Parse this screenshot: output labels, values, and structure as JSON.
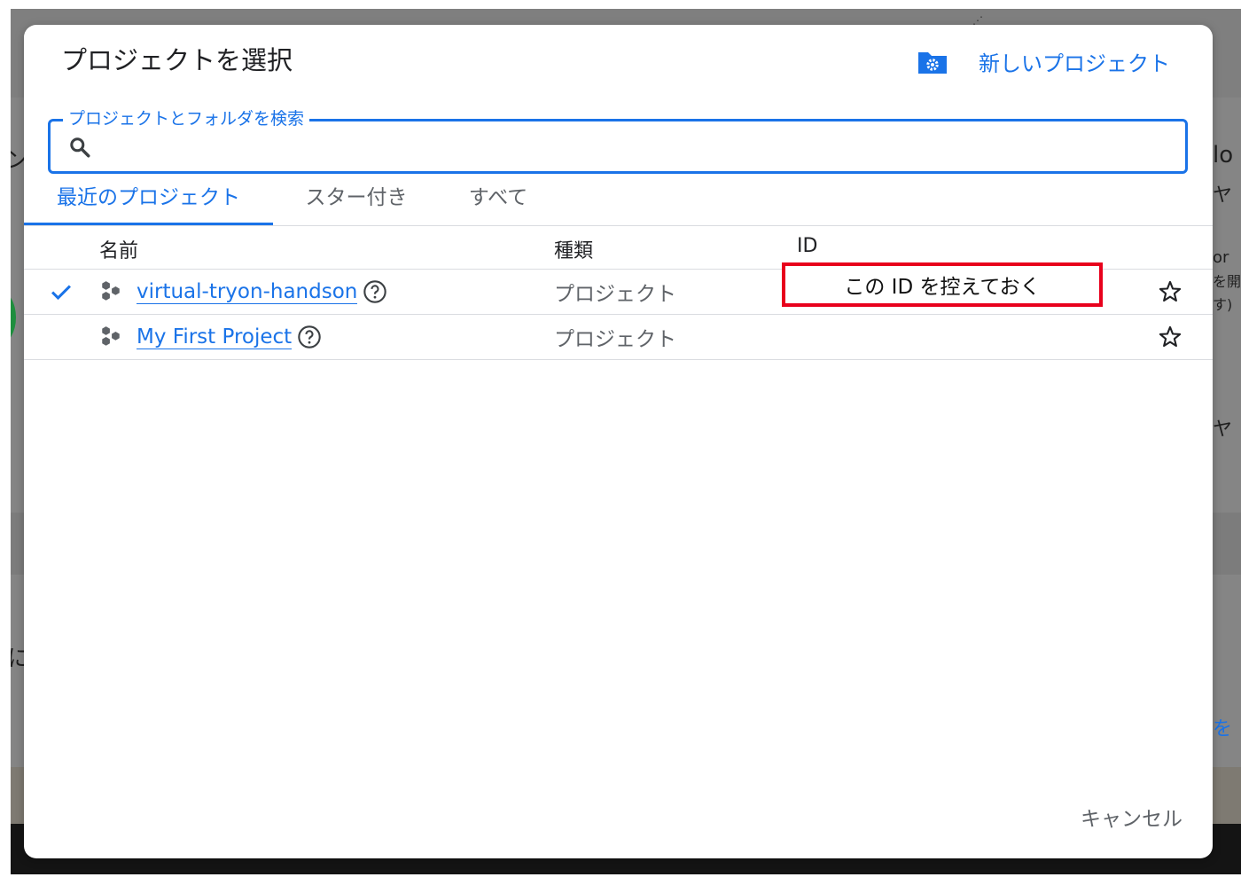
{
  "background": {
    "fragments": [
      "ン",
      "lo",
      "ヤ",
      "or",
      "を開",
      "す)",
      "ヤ",
      "に",
      "を"
    ]
  },
  "dialog": {
    "title": "プロジェクトを選択",
    "new_project_label": "新しいプロジェクト",
    "new_project_icon": "folder-settings-icon",
    "search": {
      "label": "プロジェクトとフォルダを検索",
      "value": "",
      "icon": "search-icon"
    },
    "tabs": [
      {
        "label": "最近のプロジェクト",
        "active": true
      },
      {
        "label": "スター付き",
        "active": false
      },
      {
        "label": "すべて",
        "active": false
      }
    ],
    "table": {
      "columns": [
        "名前",
        "種類",
        "ID"
      ],
      "rows": [
        {
          "selected": true,
          "name": "virtual-tryon-handson",
          "type": "プロジェクト",
          "id": "",
          "starred": false
        },
        {
          "selected": false,
          "name": "My First Project",
          "type": "プロジェクト",
          "id": "",
          "starred": false
        }
      ]
    },
    "annotation": "この ID を控えておく",
    "cancel_label": "キャンセル"
  },
  "colors": {
    "accent": "#1a73e8",
    "annotation_border": "#e8001c",
    "secondary_text": "#5f6368",
    "backdrop": "#858585"
  }
}
